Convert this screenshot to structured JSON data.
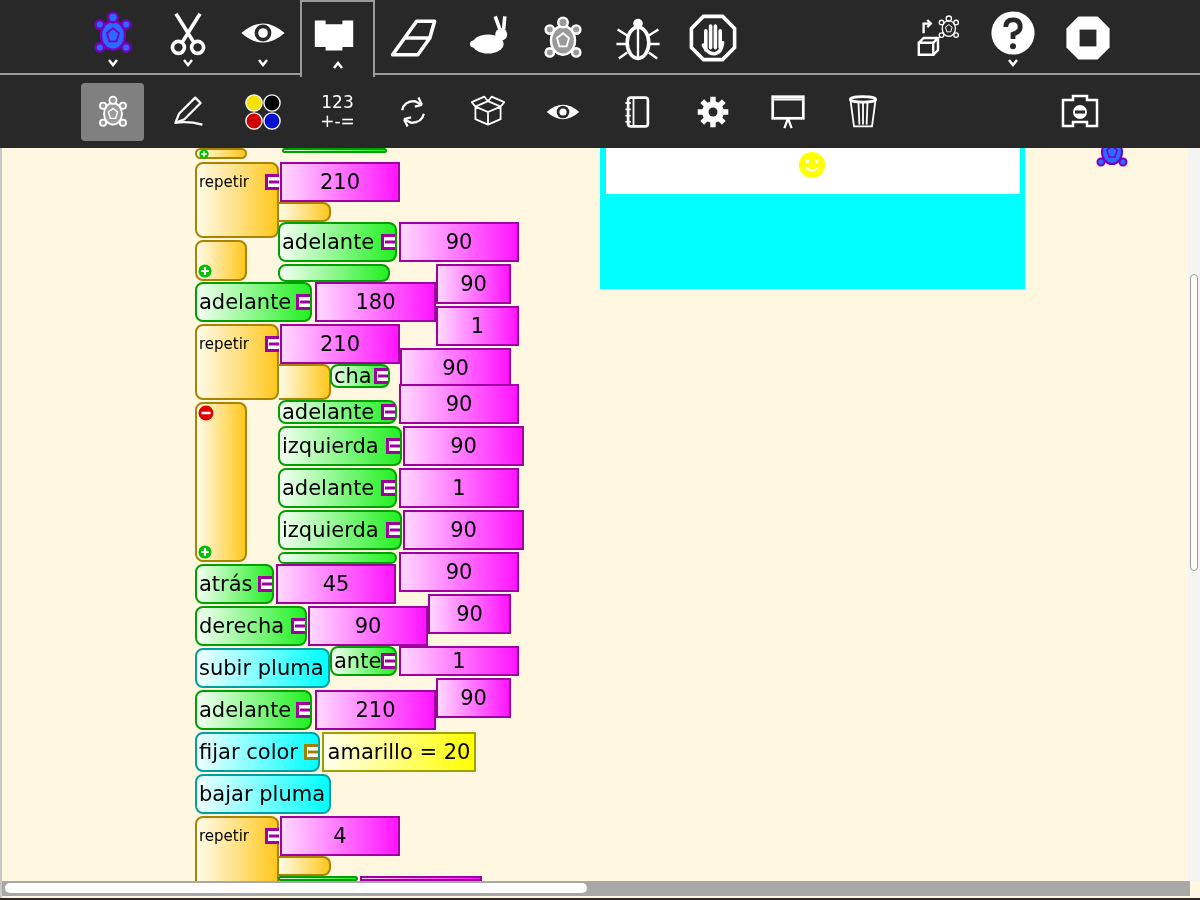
{
  "main_toolbar": {
    "items": [
      {
        "kind": "turtle",
        "color": "#2a6bff",
        "dropdown": true,
        "selected": false
      },
      {
        "kind": "scissors",
        "dropdown": true,
        "selected": false
      },
      {
        "kind": "eye",
        "dropdown": true,
        "selected": false
      },
      {
        "kind": "blocks",
        "dropdown": true,
        "selected": true
      },
      {
        "kind": "eraser",
        "dropdown": false,
        "selected": false
      },
      {
        "kind": "rabbit",
        "dropdown": false,
        "selected": false
      },
      {
        "kind": "turtle",
        "color": "#9a9a9a",
        "dropdown": false,
        "selected": false
      },
      {
        "kind": "bug",
        "dropdown": false,
        "selected": false
      },
      {
        "kind": "hand",
        "dropdown": false,
        "selected": false
      },
      {
        "kind": "share",
        "dropdown": false,
        "selected": false
      },
      {
        "kind": "help",
        "dropdown": true,
        "selected": false
      },
      {
        "kind": "stop",
        "dropdown": false,
        "selected": false
      }
    ]
  },
  "palette_toolbar": {
    "items": [
      {
        "kind": "turtle",
        "selected": true
      },
      {
        "kind": "pen",
        "selected": false
      },
      {
        "kind": "colors",
        "selected": false
      },
      {
        "kind": "numbers",
        "lines": [
          "123",
          "+-="
        ],
        "selected": false
      },
      {
        "kind": "arrows",
        "selected": false
      },
      {
        "kind": "box",
        "selected": false
      },
      {
        "kind": "eye",
        "selected": false
      },
      {
        "kind": "notebook",
        "selected": false
      },
      {
        "kind": "gear",
        "selected": false
      },
      {
        "kind": "easel",
        "selected": false
      },
      {
        "kind": "trash",
        "selected": false
      },
      {
        "kind": "collapse",
        "selected": false
      }
    ]
  },
  "canvas": {
    "blocks": [
      {
        "kind": "stub"
      },
      {
        "kind": "command"
      },
      {
        "kind": "repeat",
        "label": "repetir"
      },
      {
        "kind": "number",
        "text": "210"
      },
      {
        "kind": "command",
        "label": "adelante"
      },
      {
        "kind": "number",
        "text": "90"
      },
      {
        "kind": "stub"
      },
      {
        "kind": "command"
      },
      {
        "kind": "number",
        "text": "90"
      },
      {
        "kind": "command",
        "label": "adelante"
      },
      {
        "kind": "number",
        "text": "180"
      },
      {
        "kind": "number",
        "text": "1"
      },
      {
        "kind": "repeat",
        "label": "repetir"
      },
      {
        "kind": "number",
        "text": "210"
      },
      {
        "kind": "number",
        "text": "90"
      },
      {
        "kind": "command",
        "label": "cha"
      },
      {
        "kind": "number",
        "text": "90"
      },
      {
        "kind": "command",
        "label": "adelante"
      },
      {
        "kind": "bracket"
      },
      {
        "kind": "command",
        "label": "izquierda"
      },
      {
        "kind": "number",
        "text": "90"
      },
      {
        "kind": "command",
        "label": "adelante"
      },
      {
        "kind": "number",
        "text": "1"
      },
      {
        "kind": "command",
        "label": "izquierda"
      },
      {
        "kind": "number",
        "text": "90"
      },
      {
        "kind": "command"
      },
      {
        "kind": "number",
        "text": "90"
      },
      {
        "kind": "command",
        "label": "atrás"
      },
      {
        "kind": "number",
        "text": "45"
      },
      {
        "kind": "number",
        "text": "90"
      },
      {
        "kind": "command",
        "label": "derecha"
      },
      {
        "kind": "number",
        "text": "90"
      },
      {
        "kind": "command",
        "label": "ante"
      },
      {
        "kind": "number",
        "text": "1"
      },
      {
        "kind": "pen",
        "label": "subir pluma"
      },
      {
        "kind": "number",
        "text": "90"
      },
      {
        "kind": "command",
        "label": "adelante"
      },
      {
        "kind": "number",
        "text": "210"
      },
      {
        "kind": "pen",
        "label": "fijar color"
      },
      {
        "kind": "color",
        "text": "amarillo = 20"
      },
      {
        "kind": "pen",
        "label": "bajar pluma"
      },
      {
        "kind": "repeat",
        "label": "repetir"
      },
      {
        "kind": "number",
        "text": "4"
      },
      {
        "kind": "command"
      },
      {
        "kind": "number"
      }
    ]
  }
}
